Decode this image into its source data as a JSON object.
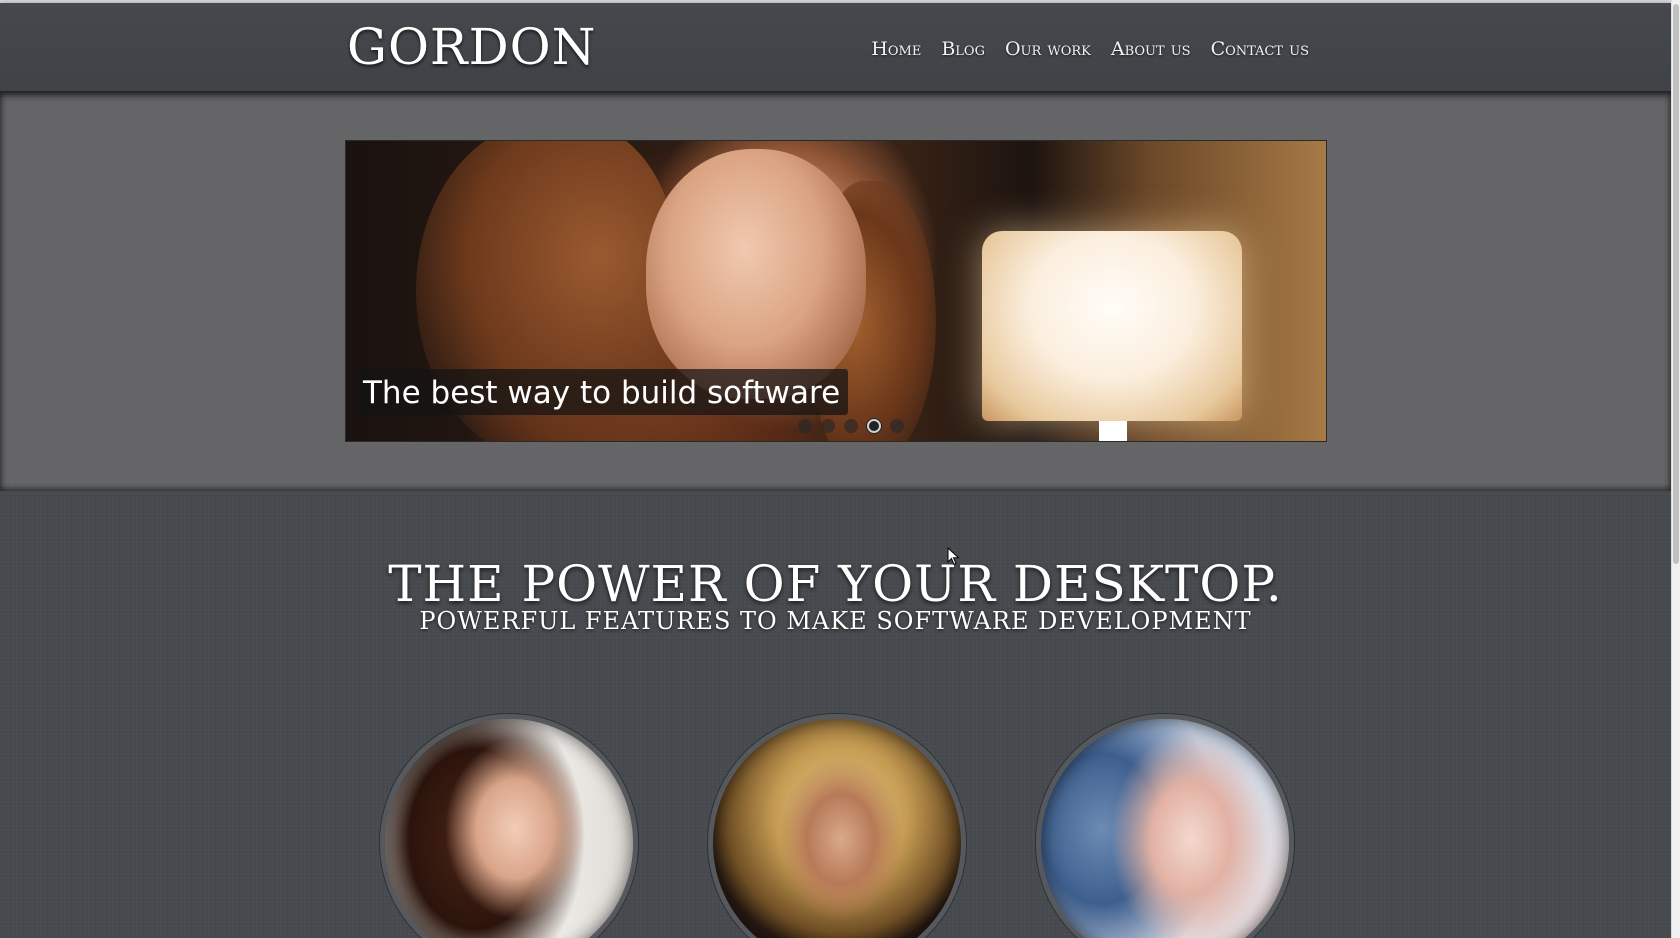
{
  "site": {
    "logo": "GORDON"
  },
  "nav": {
    "items": [
      {
        "label": "Home"
      },
      {
        "label": "Blog"
      },
      {
        "label": "Our work"
      },
      {
        "label": "About us"
      },
      {
        "label": "Contact us"
      }
    ]
  },
  "slider": {
    "caption": "The best way to build software",
    "dots": 5,
    "active_dot": 4
  },
  "hero": {
    "headline": "THE POWER OF YOUR DESKTOP.",
    "subheadline": "POWERFUL FEATURES TO MAKE SOFTWARE DEVELOPMENT"
  },
  "portraits": {
    "count": 3
  },
  "colors": {
    "page_background": "#474a4e",
    "slider_band": "#636466",
    "text": "#ffffff"
  }
}
